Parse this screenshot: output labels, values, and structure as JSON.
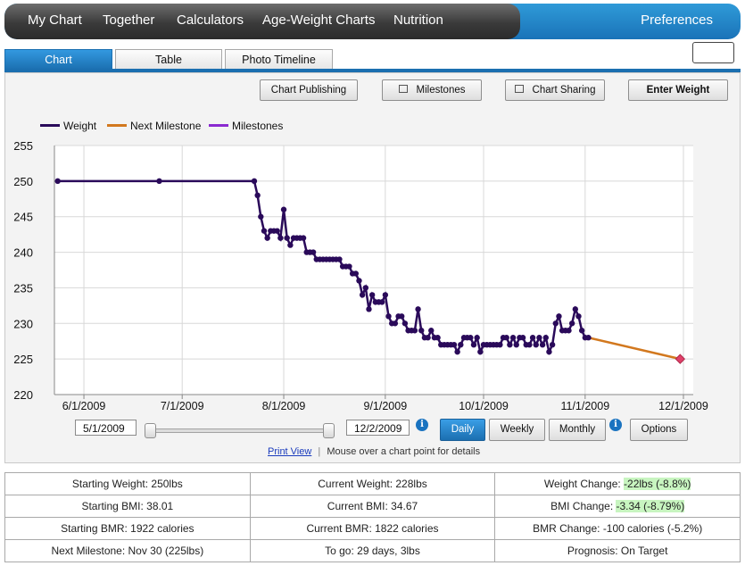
{
  "nav": {
    "items": [
      "My Chart",
      "Together",
      "Calculators",
      "Age-Weight Charts",
      "Nutrition"
    ],
    "preferences": "Preferences"
  },
  "tabs": [
    "Chart",
    "Table",
    "Photo Timeline"
  ],
  "toolbar": {
    "chart_publishing": "Chart Publishing",
    "milestones": "Milestones",
    "chart_sharing": "Chart Sharing",
    "enter_weight": "Enter Weight"
  },
  "controls": {
    "start_date": "5/1/2009",
    "end_date": "12/2/2009",
    "periods": [
      "Daily",
      "Weekly",
      "Monthly"
    ],
    "active_period": "Daily",
    "options": "Options",
    "info_glyph": "i",
    "print_view": "Print View",
    "separator": "|",
    "hint": "Mouse over a chart point for details"
  },
  "chart_data": {
    "type": "line",
    "legend": [
      "Weight",
      "Next Milestone",
      "Milestones"
    ],
    "ylim": [
      220,
      255
    ],
    "yticks": [
      220,
      225,
      230,
      235,
      240,
      245,
      250,
      255
    ],
    "xticks": [
      "6/1/2009",
      "7/1/2009",
      "8/1/2009",
      "9/1/2009",
      "10/1/2009",
      "11/1/2009",
      "12/1/2009"
    ],
    "xlim": [
      "2009-05-23",
      "2009-12-04"
    ],
    "colors": {
      "weight": "#2a0a5a",
      "next_milestone": "#d2781e",
      "milestones": "#8a2ad0",
      "milestone_marker": "#e0406a"
    },
    "series": [
      {
        "name": "Weight",
        "points": [
          [
            "2009-05-24",
            250
          ],
          [
            "2009-06-24",
            250
          ],
          [
            "2009-07-23",
            250
          ],
          [
            "2009-07-24",
            248
          ],
          [
            "2009-07-25",
            245
          ],
          [
            "2009-07-26",
            243
          ],
          [
            "2009-07-27",
            242
          ],
          [
            "2009-07-28",
            243
          ],
          [
            "2009-07-29",
            243
          ],
          [
            "2009-07-30",
            243
          ],
          [
            "2009-07-31",
            242
          ],
          [
            "2009-08-01",
            246
          ],
          [
            "2009-08-02",
            242
          ],
          [
            "2009-08-03",
            241
          ],
          [
            "2009-08-04",
            242
          ],
          [
            "2009-08-05",
            242
          ],
          [
            "2009-08-06",
            242
          ],
          [
            "2009-08-07",
            242
          ],
          [
            "2009-08-08",
            240
          ],
          [
            "2009-08-09",
            240
          ],
          [
            "2009-08-10",
            240
          ],
          [
            "2009-08-11",
            239
          ],
          [
            "2009-08-12",
            239
          ],
          [
            "2009-08-13",
            239
          ],
          [
            "2009-08-14",
            239
          ],
          [
            "2009-08-15",
            239
          ],
          [
            "2009-08-16",
            239
          ],
          [
            "2009-08-17",
            239
          ],
          [
            "2009-08-18",
            239
          ],
          [
            "2009-08-19",
            238
          ],
          [
            "2009-08-20",
            238
          ],
          [
            "2009-08-21",
            238
          ],
          [
            "2009-08-22",
            237
          ],
          [
            "2009-08-23",
            237
          ],
          [
            "2009-08-24",
            236
          ],
          [
            "2009-08-25",
            234
          ],
          [
            "2009-08-26",
            235
          ],
          [
            "2009-08-27",
            232
          ],
          [
            "2009-08-28",
            234
          ],
          [
            "2009-08-29",
            233
          ],
          [
            "2009-08-30",
            233
          ],
          [
            "2009-08-31",
            233
          ],
          [
            "2009-09-01",
            234
          ],
          [
            "2009-09-02",
            231
          ],
          [
            "2009-09-03",
            230
          ],
          [
            "2009-09-04",
            230
          ],
          [
            "2009-09-05",
            231
          ],
          [
            "2009-09-06",
            231
          ],
          [
            "2009-09-07",
            230
          ],
          [
            "2009-09-08",
            229
          ],
          [
            "2009-09-09",
            229
          ],
          [
            "2009-09-10",
            229
          ],
          [
            "2009-09-11",
            232
          ],
          [
            "2009-09-12",
            229
          ],
          [
            "2009-09-13",
            228
          ],
          [
            "2009-09-14",
            228
          ],
          [
            "2009-09-15",
            229
          ],
          [
            "2009-09-16",
            228
          ],
          [
            "2009-09-17",
            228
          ],
          [
            "2009-09-18",
            227
          ],
          [
            "2009-09-19",
            227
          ],
          [
            "2009-09-20",
            227
          ],
          [
            "2009-09-21",
            227
          ],
          [
            "2009-09-22",
            227
          ],
          [
            "2009-09-23",
            226
          ],
          [
            "2009-09-24",
            227
          ],
          [
            "2009-09-25",
            228
          ],
          [
            "2009-09-26",
            228
          ],
          [
            "2009-09-27",
            228
          ],
          [
            "2009-09-28",
            227
          ],
          [
            "2009-09-29",
            228
          ],
          [
            "2009-09-30",
            226
          ],
          [
            "2009-10-01",
            227
          ],
          [
            "2009-10-02",
            227
          ],
          [
            "2009-10-03",
            227
          ],
          [
            "2009-10-04",
            227
          ],
          [
            "2009-10-05",
            227
          ],
          [
            "2009-10-06",
            227
          ],
          [
            "2009-10-07",
            228
          ],
          [
            "2009-10-08",
            228
          ],
          [
            "2009-10-09",
            227
          ],
          [
            "2009-10-10",
            228
          ],
          [
            "2009-10-11",
            227
          ],
          [
            "2009-10-12",
            228
          ],
          [
            "2009-10-13",
            228
          ],
          [
            "2009-10-14",
            227
          ],
          [
            "2009-10-15",
            227
          ],
          [
            "2009-10-16",
            228
          ],
          [
            "2009-10-17",
            227
          ],
          [
            "2009-10-18",
            228
          ],
          [
            "2009-10-19",
            227
          ],
          [
            "2009-10-20",
            228
          ],
          [
            "2009-10-21",
            226
          ],
          [
            "2009-10-22",
            227
          ],
          [
            "2009-10-23",
            230
          ],
          [
            "2009-10-24",
            231
          ],
          [
            "2009-10-25",
            229
          ],
          [
            "2009-10-26",
            229
          ],
          [
            "2009-10-27",
            229
          ],
          [
            "2009-10-28",
            230
          ],
          [
            "2009-10-29",
            232
          ],
          [
            "2009-10-30",
            231
          ],
          [
            "2009-10-31",
            229
          ],
          [
            "2009-11-01",
            228
          ],
          [
            "2009-11-02",
            228
          ]
        ]
      },
      {
        "name": "Next Milestone",
        "points": [
          [
            "2009-11-02",
            228
          ],
          [
            "2009-11-30",
            225
          ]
        ]
      }
    ]
  },
  "stats": [
    [
      {
        "label": "Starting Weight: 250lbs"
      },
      {
        "label": "Current Weight: 228lbs"
      },
      {
        "label": "Weight Change: ",
        "value": "-22lbs (-8.8%)"
      }
    ],
    [
      {
        "label": "Starting BMI: 38.01"
      },
      {
        "label": "Current BMI: 34.67"
      },
      {
        "label": "BMI Change: ",
        "value": "-3.34 (-8.79%)"
      }
    ],
    [
      {
        "label": "Starting BMR: 1922 calories"
      },
      {
        "label": "Current BMR: 1822 calories"
      },
      {
        "label": "BMR Change: -100 calories (-5.2%)"
      }
    ],
    [
      {
        "label": "Next Milestone: Nov 30 (225lbs)"
      },
      {
        "label": "To go: 29 days, 3lbs"
      },
      {
        "label": "Prognosis: On Target"
      }
    ]
  ]
}
